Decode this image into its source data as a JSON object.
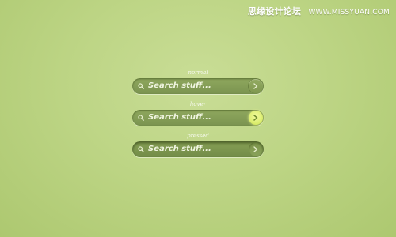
{
  "watermark": {
    "chinese": "思缘设计论坛",
    "url": "WWW.MISSYUAN.COM"
  },
  "states": [
    {
      "label": "normal",
      "placeholder": "Search stuff...",
      "button_state": "normal"
    },
    {
      "label": "hover",
      "placeholder": "Search stuff...",
      "button_state": "hover"
    },
    {
      "label": "pressed",
      "placeholder": "Search stuff...",
      "button_state": "pressed"
    }
  ],
  "colors": {
    "background": "#bdd585",
    "field": "#839c55",
    "text": "#f3f7e6",
    "hover_accent": "#e6f27a"
  },
  "icons": {
    "search": "magnifier-icon",
    "submit": "chevron-right-icon"
  }
}
